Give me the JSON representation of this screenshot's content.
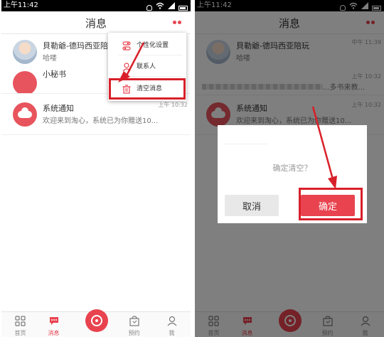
{
  "statusbar": {
    "time": "上午11:42"
  },
  "header": {
    "title": "消息"
  },
  "conversations": [
    {
      "name": "貝勒爺-德玛西亚陪玩",
      "preview": "哈喽",
      "time": "中午 11:39"
    },
    {
      "name": "小秘书",
      "preview": "...多书来教...",
      "time": "上午 10:32"
    },
    {
      "name": "系统通知",
      "preview": "欢迎来到淘心，系统已为你赠送10...",
      "time": "上午 10:32"
    }
  ],
  "menu": {
    "items": [
      {
        "label": "个性化设置",
        "icon": "settings-toggle-icon"
      },
      {
        "label": "联系人",
        "icon": "person-icon"
      },
      {
        "label": "清空消息",
        "icon": "trash-icon"
      }
    ]
  },
  "dialog": {
    "message": "确定清空？",
    "cancel": "取消",
    "confirm": "确定"
  },
  "tabs": [
    {
      "label": "首页",
      "icon": "grid-icon"
    },
    {
      "label": "消息",
      "icon": "chat-icon"
    },
    {
      "label": "",
      "icon": "disc-icon"
    },
    {
      "label": "预约",
      "icon": "bag-icon"
    },
    {
      "label": "我",
      "icon": "person-icon"
    }
  ],
  "colors": {
    "accent": "#e8434f",
    "highlight": "#d8202a"
  }
}
